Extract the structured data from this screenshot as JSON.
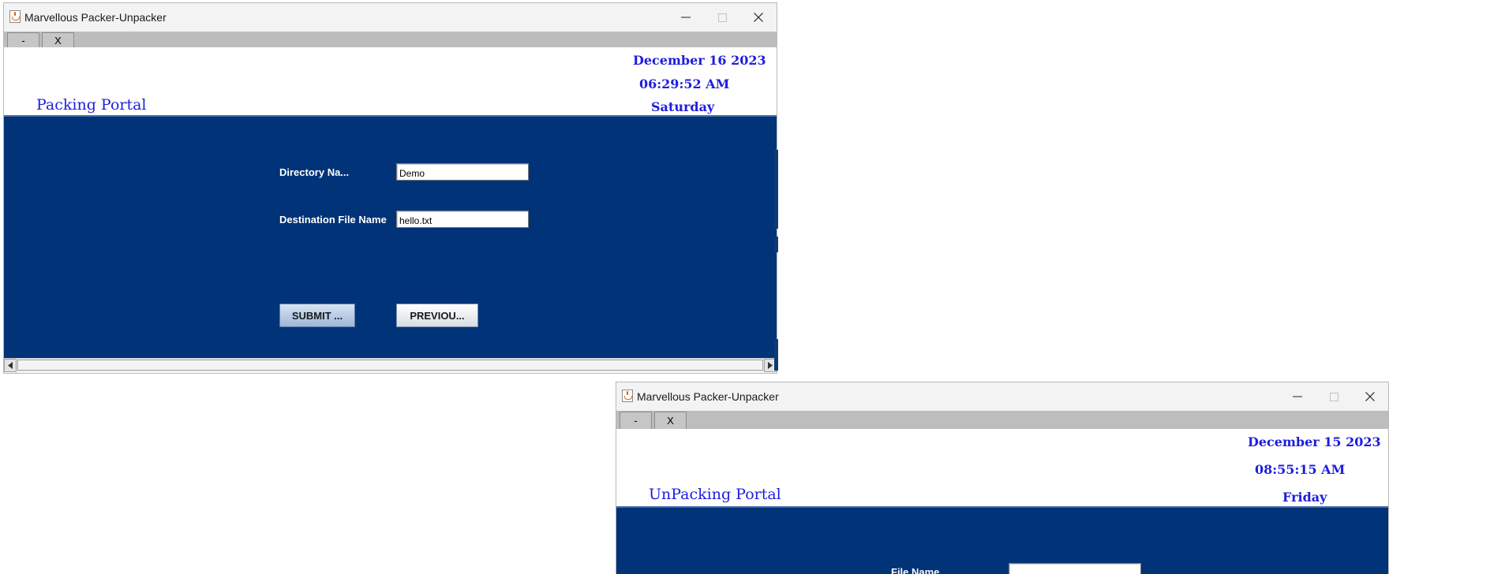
{
  "window1": {
    "title": "Marvellous Packer-Unpacker",
    "tabs": [
      "-",
      "X"
    ],
    "portal_title": "Packing Portal",
    "date": "December 16 2023",
    "time": "06:29:52 AM",
    "day": "Saturday",
    "fields": [
      {
        "label": "Directory Na...",
        "value": "Demo"
      },
      {
        "label": "Destination File Name",
        "value": "hello.txt"
      }
    ],
    "buttons": {
      "submit": "SUBMIT ...",
      "previous": "PREVIOU..."
    }
  },
  "window2": {
    "title": "Marvellous Packer-Unpacker",
    "tabs": [
      "-",
      "X"
    ],
    "portal_title": "UnPacking Portal",
    "date": "December 15 2023",
    "time": "08:55:15 AM",
    "day": "Friday",
    "fields": [
      {
        "label": "File Name",
        "value": ""
      }
    ]
  },
  "colors": {
    "panel": "#003378",
    "header_text": "#1d1ddf",
    "titlebar": "#f3f3f3"
  },
  "icons": [
    "java-cup-icon",
    "minimize-icon",
    "maximize-icon",
    "close-icon",
    "scroll-left-icon",
    "scroll-right-icon"
  ]
}
